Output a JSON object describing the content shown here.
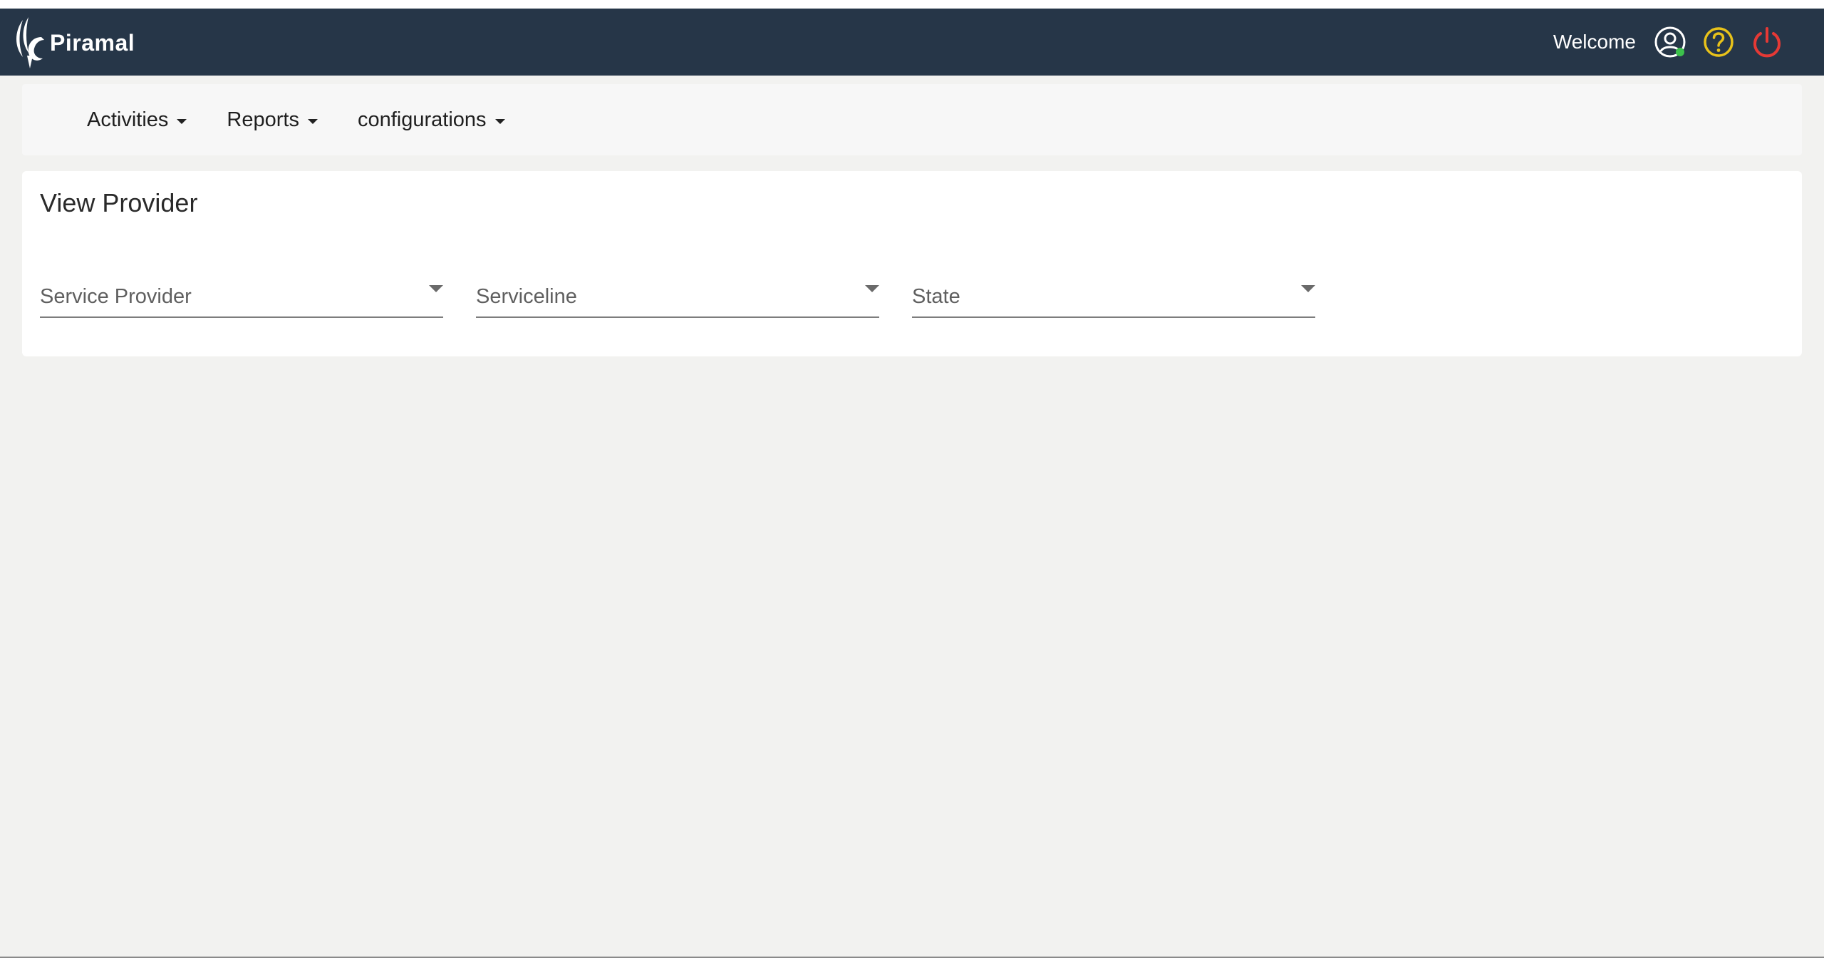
{
  "header": {
    "brand": "Piramal",
    "welcome": "Welcome",
    "icons": {
      "user": "user-circle-icon",
      "status_color": "#3cc14c",
      "help": "question-circle-icon",
      "help_color": "#e8c21a",
      "logout": "power-icon",
      "logout_color": "#e53935"
    },
    "background": "#263648"
  },
  "nav": {
    "items": [
      {
        "label": "Activities"
      },
      {
        "label": "Reports"
      },
      {
        "label": "configurations"
      }
    ]
  },
  "card": {
    "title": "View Provider",
    "selects": [
      {
        "label": "Service Provider"
      },
      {
        "label": "Serviceline"
      },
      {
        "label": "State"
      }
    ]
  }
}
